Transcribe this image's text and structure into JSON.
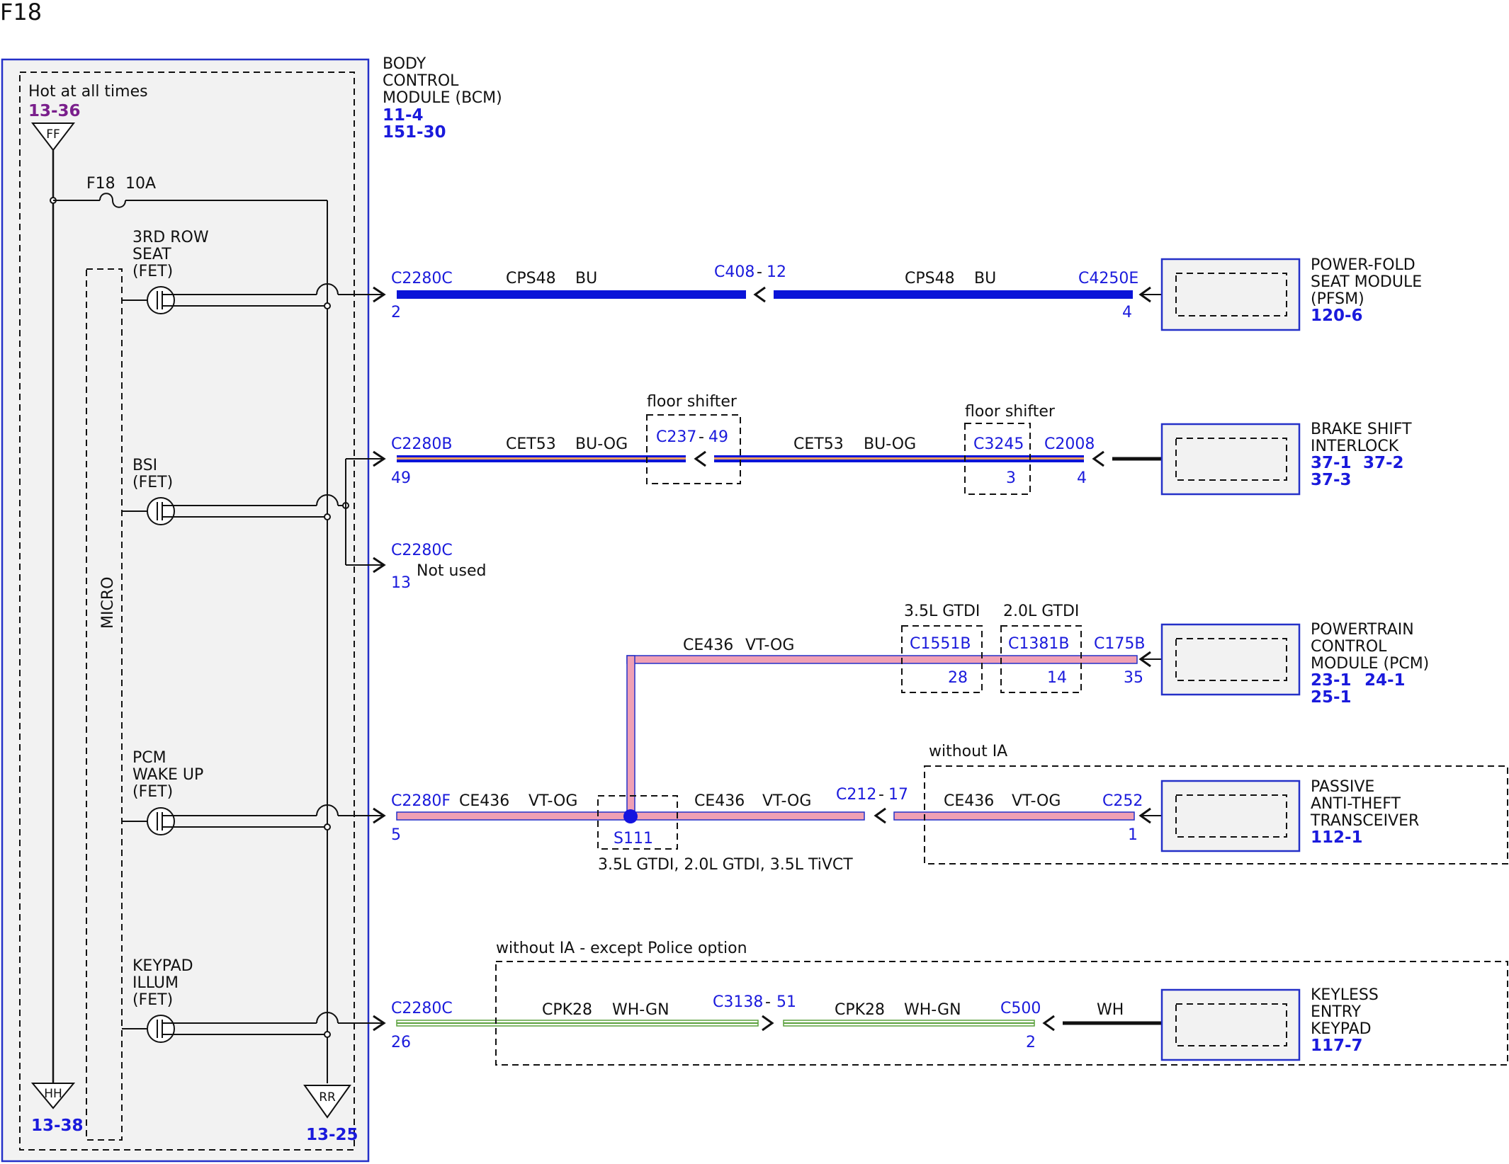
{
  "page_title": "F18",
  "bcm": {
    "hot_label": "Hot at all times",
    "hot_ref": "13-36",
    "ff_label": "FF",
    "fuse_label": "F18",
    "fuse_rating": "10A",
    "title": [
      "BODY",
      "CONTROL",
      "MODULE (BCM)"
    ],
    "refs": [
      "11-4",
      "151-30"
    ],
    "micro_label": "MICRO",
    "hh_label": "HH",
    "hh_ref": "13-38",
    "rr_label": "RR",
    "rr_ref": "13-25",
    "outputs": [
      [
        "3RD ROW",
        "SEAT",
        "(FET)"
      ],
      [
        "BSI",
        "(FET)"
      ],
      [
        "PCM",
        "WAKE UP",
        "(FET)"
      ],
      [
        "KEYPAD",
        "ILLUM",
        "(FET)"
      ]
    ]
  },
  "circuits": {
    "pfsm": {
      "bcm_conn": "C2280C",
      "bcm_pin": "2",
      "circuit1": "CPS48",
      "color1": "BU",
      "inline_conn": "C408",
      "inline_pin": "12",
      "circuit2": "CPS48",
      "color2": "BU",
      "dev_conn": "C4250E",
      "dev_pin": "4",
      "device": [
        "POWER-FOLD",
        "SEAT MODULE",
        "(PFSM)"
      ],
      "device_refs": [
        "120-6"
      ]
    },
    "bsi": {
      "bcm_conn": "C2280B",
      "bcm_pin": "49",
      "circuit1": "CET53",
      "color1": "BU-OG",
      "inline_conn": "C237",
      "inline_pin": "49",
      "inline_note": "floor shifter",
      "circuit2": "CET53",
      "color2": "BU-OG",
      "c3245": "C3245",
      "c3245_pin": "3",
      "c3245_note": "floor shifter",
      "dev_conn": "C2008",
      "dev_pin": "4",
      "device": [
        "BRAKE SHIFT",
        "INTERLOCK"
      ],
      "device_refs": [
        "37-1",
        "37-2",
        "37-3"
      ]
    },
    "not_used": {
      "bcm_conn": "C2280C",
      "bcm_pin": "13",
      "label": "Not used"
    },
    "pcm": {
      "circuit": "CE436",
      "color": "VT-OG",
      "c1551_note": "3.5L GTDI",
      "c1551": "C1551B",
      "c1551_pin": "28",
      "c1381_note": "2.0L GTDI",
      "c1381": "C1381B",
      "c1381_pin": "14",
      "dev_conn": "C175B",
      "dev_pin": "35",
      "device": [
        "POWERTRAIN",
        "CONTROL",
        "MODULE (PCM)"
      ],
      "device_refs": [
        "23-1",
        "24-1",
        "25-1"
      ]
    },
    "pats": {
      "bcm_conn": "C2280F",
      "bcm_pin": "5",
      "circuit1": "CE436",
      "color1": "VT-OG",
      "splice": "S111",
      "splice_note": "3.5L GTDI, 2.0L GTDI, 3.5L TiVCT",
      "circuit2": "CE436",
      "color2": "VT-OG",
      "inline_conn": "C212",
      "inline_pin": "17",
      "zone_note": "without IA",
      "circuit3": "CE436",
      "color3": "VT-OG",
      "dev_conn": "C252",
      "dev_pin": "1",
      "device": [
        "PASSIVE",
        "ANTI-THEFT",
        "TRANSCEIVER"
      ],
      "device_refs": [
        "112-1"
      ]
    },
    "keypad": {
      "bcm_conn": "C2280C",
      "bcm_pin": "26",
      "zone_note": "without IA - except Police option",
      "circuit1": "CPK28",
      "color1": "WH-GN",
      "inline_conn": "C3138",
      "inline_pin": "51",
      "circuit2": "CPK28",
      "color2": "WH-GN",
      "dev_conn": "C500",
      "dev_pin": "2",
      "color3": "WH",
      "device": [
        "KEYLESS",
        "ENTRY",
        "KEYPAD"
      ],
      "device_refs": [
        "117-7"
      ]
    }
  },
  "colors": {
    "blue_ref": "#1a1adc",
    "purple_ref": "#7a1f8c",
    "wire_bu": "#0a14d8",
    "wire_vt_og": "#f0a0b4",
    "wire_wh_gn": "#5aa03c",
    "module_border": "#2430c8",
    "module_fill": "#f2f2f2"
  }
}
